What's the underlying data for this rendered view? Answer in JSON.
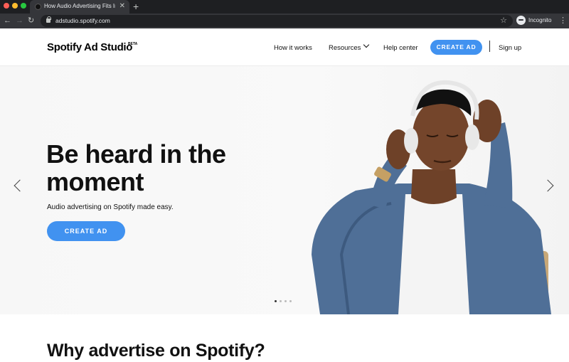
{
  "browser": {
    "tab_title": "How Audio Advertising Fits Into",
    "tab_close": "✕",
    "new_tab": "+",
    "url": "adstudio.spotify.com",
    "profile_label": "Incognito",
    "back": "←",
    "forward": "→",
    "reload": "↻",
    "star": "☆",
    "menu": "⋮"
  },
  "header": {
    "logo": "Spotify Ad Studio",
    "logo_badge": "BETA",
    "nav": {
      "how_it_works": "How it works",
      "resources": "Resources",
      "help_center": "Help center",
      "create_ad": "CREATE AD",
      "sign_up": "Sign up"
    }
  },
  "hero": {
    "headline": "Be heard in the moment",
    "subheadline": "Audio advertising on Spotify made easy.",
    "cta": "CREATE AD",
    "carousel_total": 4,
    "carousel_active": 1
  },
  "section": {
    "title": "Why advertise on Spotify?"
  },
  "colors": {
    "accent": "#4192f0",
    "chrome_dark": "#35363a",
    "text": "#111111"
  },
  "icons": [
    "back-icon",
    "forward-icon",
    "reload-icon",
    "lock-icon",
    "star-icon",
    "incognito-icon",
    "menu-dots-icon",
    "chevron-down-icon",
    "arrow-left-icon",
    "arrow-right-icon"
  ]
}
